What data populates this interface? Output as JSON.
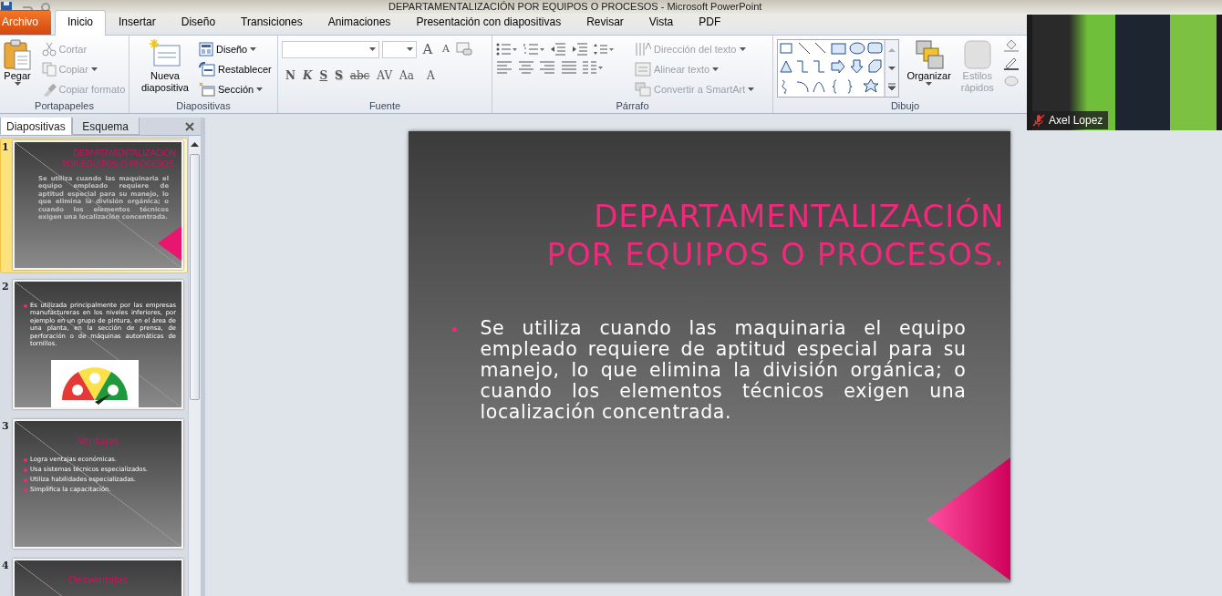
{
  "window": {
    "title": "DEPARTAMENTALIZACIÓN POR EQUIPOS O PROCESOS  -  Microsoft PowerPoint"
  },
  "ribbon_tabs": [
    {
      "label": "Archivo",
      "kind": "file",
      "selected": false
    },
    {
      "label": "Inicio",
      "kind": "tab",
      "selected": true
    },
    {
      "label": "Insertar",
      "kind": "tab",
      "selected": false
    },
    {
      "label": "Diseño",
      "kind": "tab",
      "selected": false
    },
    {
      "label": "Transiciones",
      "kind": "tab",
      "selected": false
    },
    {
      "label": "Animaciones",
      "kind": "tab",
      "selected": false
    },
    {
      "label": "Presentación con diapositivas",
      "kind": "tab",
      "selected": false
    },
    {
      "label": "Revisar",
      "kind": "tab",
      "selected": false
    },
    {
      "label": "Vista",
      "kind": "tab",
      "selected": false
    },
    {
      "label": "PDF",
      "kind": "tab",
      "selected": false
    }
  ],
  "clipboard_group": {
    "label": "Portapapeles",
    "paste": {
      "label": "Pegar"
    },
    "items": [
      {
        "label": "Cortar",
        "disabled": true
      },
      {
        "label": "Copiar",
        "disabled": true
      },
      {
        "label": "Copiar formato",
        "disabled": true
      }
    ]
  },
  "slides_group": {
    "label": "Diapositivas",
    "new_slide": {
      "label": "Nueva diapositiva"
    },
    "items": [
      {
        "label": "Diseño",
        "disabled": false
      },
      {
        "label": "Restablecer",
        "disabled": false
      },
      {
        "label": "Sección",
        "disabled": false
      }
    ]
  },
  "font_group": {
    "label": "Fuente",
    "size_buttons": [
      "A",
      "A"
    ],
    "format_buttons": [
      "N",
      "K",
      "S",
      "S",
      "abc",
      "AV",
      "Aa",
      "A"
    ]
  },
  "paragraph_group": {
    "label": "Párrafo",
    "items": [
      {
        "label": "Dirección del texto",
        "disabled": true
      },
      {
        "label": "Alinear texto",
        "disabled": true
      },
      {
        "label": "Convertir a SmartArt",
        "disabled": true
      }
    ]
  },
  "drawing_group": {
    "label": "Dibujo",
    "arrange": {
      "label": "Organizar"
    },
    "quick_styles": {
      "label": "Estilos rápidos",
      "disabled": true
    }
  },
  "pane_tabs": [
    {
      "label": "Diapositivas",
      "selected": true
    },
    {
      "label": "Esquema",
      "selected": false
    }
  ],
  "thumbnails": [
    {
      "number": "1",
      "selected": true,
      "title_lines": [
        "DEPARTAMENTALIZACIÓN",
        "POR EQUIPOS O PROCESOS."
      ],
      "body": "Se utiliza cuando las maquinaria el equipo empleado requiere de aptitud especial para su manejo, lo que elimina la división orgánica; o cuando los elementos técnicos exigen una localización concentrada."
    },
    {
      "number": "2",
      "selected": false,
      "bullets": [
        "Es utilizada principalmente por las empresas manufactureras en los niveles inferiores, por ejemplo en un grupo de pintura, en el área de una planta, en la sección de prensa, de perforación o de máquinas automáticas de tornillos."
      ]
    },
    {
      "number": "3",
      "selected": false,
      "title_lines": [
        "Ventajas"
      ],
      "bullets": [
        "Logra ventajas económicas.",
        "Usa sistemas técnicos especializados.",
        "Utiliza habilidades especializadas.",
        "Simplifica la capacitación."
      ]
    },
    {
      "number": "4",
      "selected": false,
      "title_lines": [
        "Desventajas"
      ]
    }
  ],
  "slide": {
    "title_lines": [
      "DEPARTAMENTALIZACIÓN",
      "POR EQUIPOS O PROCESOS."
    ],
    "bullets": [
      "Se utiliza cuando las maquinaria el equipo empleado requiere de aptitud especial para su manejo, lo que elimina la división orgánica; o cuando los elementos técnicos exigen una localización concentrada."
    ]
  },
  "video": {
    "name": "Axel Lopez",
    "muted": true
  }
}
